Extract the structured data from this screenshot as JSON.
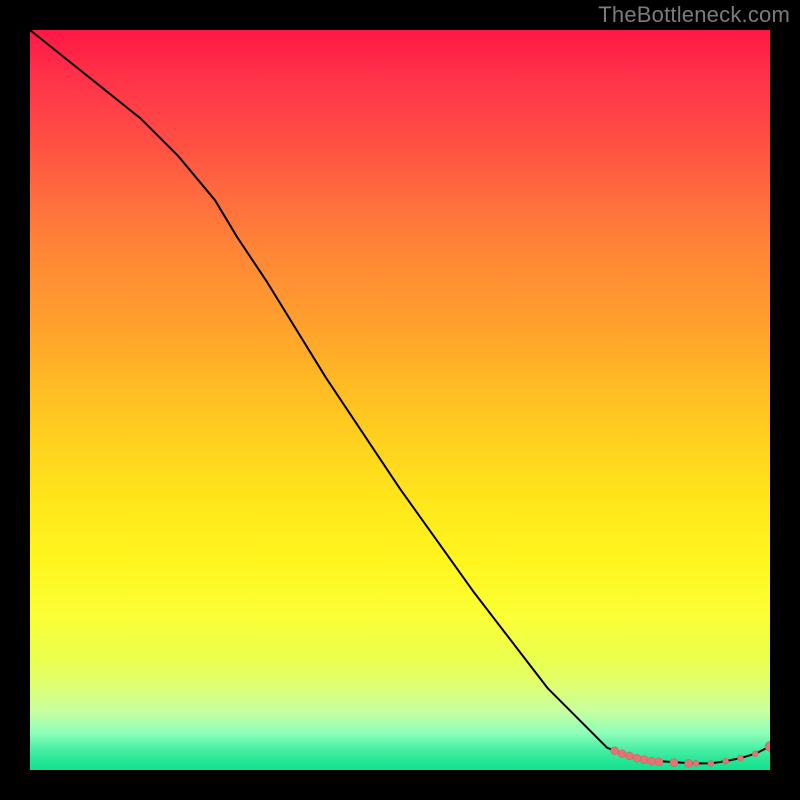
{
  "watermark": "TheBottleneck.com",
  "colors": {
    "page_bg": "#000000",
    "watermark_text": "#7b7b7b",
    "curve_stroke": "#000000",
    "point_fill": "#e57373",
    "gradient_top": "#ff1744",
    "gradient_bottom": "#17df8d"
  },
  "chart_data": {
    "type": "line",
    "title": "",
    "xlabel": "",
    "ylabel": "",
    "xlim": [
      0,
      100
    ],
    "ylim": [
      0,
      100
    ],
    "series": [
      {
        "name": "curve",
        "x": [
          0,
          5,
          10,
          15,
          20,
          25,
          28,
          32,
          40,
          50,
          60,
          70,
          78,
          82,
          85,
          88,
          90,
          92,
          94,
          96,
          98,
          100
        ],
        "y": [
          100,
          96,
          92,
          88,
          83,
          77,
          72,
          66,
          53,
          38,
          24,
          11,
          3,
          1.5,
          1.2,
          1.0,
          0.9,
          0.9,
          1.2,
          1.6,
          2.2,
          3.2
        ]
      }
    ],
    "points": {
      "name": "tail-markers",
      "x": [
        79,
        80,
        81,
        82,
        83,
        84,
        85,
        87,
        89,
        90,
        92,
        94,
        96,
        98,
        100
      ],
      "y": [
        2.6,
        2.2,
        1.9,
        1.6,
        1.4,
        1.2,
        1.1,
        1.0,
        0.9,
        0.9,
        0.9,
        1.2,
        1.6,
        2.2,
        3.2
      ],
      "r": [
        4,
        4,
        4,
        4,
        4,
        4,
        4,
        4,
        4,
        3,
        3,
        3,
        3,
        3,
        5
      ]
    }
  }
}
